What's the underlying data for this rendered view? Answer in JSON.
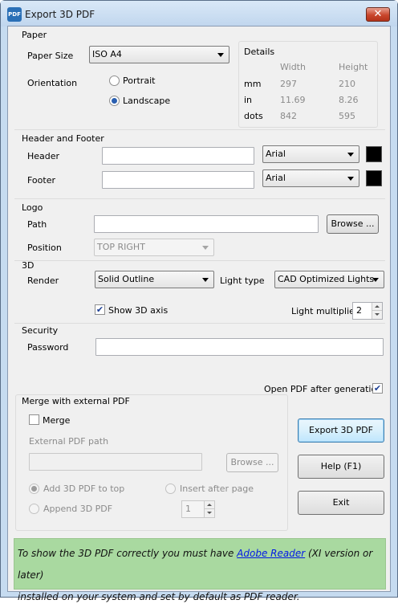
{
  "window": {
    "title": "Export 3D PDF",
    "app_icon_text": "PDF",
    "close_glyph": "✕"
  },
  "paper": {
    "group_label": "Paper",
    "size_label": "Paper Size",
    "size_value": "ISO A4",
    "orientation_label": "Orientation",
    "portrait_label": "Portrait",
    "landscape_label": "Landscape",
    "selected_orientation": "Landscape",
    "details": {
      "label": "Details",
      "col_width": "Width",
      "col_height": "Height",
      "rows": [
        {
          "unit": "mm",
          "width": "297",
          "height": "210"
        },
        {
          "unit": "in",
          "width": "11.69",
          "height": "8.26"
        },
        {
          "unit": "dots",
          "width": "842",
          "height": "595"
        }
      ]
    }
  },
  "header_footer": {
    "group_label": "Header and Footer",
    "header_label": "Header",
    "header_value": "",
    "header_font": "Arial",
    "header_color": "#000000",
    "footer_label": "Footer",
    "footer_value": "",
    "footer_font": "Arial",
    "footer_color": "#000000"
  },
  "logo": {
    "group_label": "Logo",
    "path_label": "Path",
    "path_value": "",
    "browse_label": "Browse ...",
    "position_label": "Position",
    "position_value": "TOP RIGHT"
  },
  "three_d": {
    "group_label": "3D",
    "render_label": "Render",
    "render_value": "Solid Outline",
    "light_type_label": "Light type",
    "light_type_value": "CAD Optimized Lights",
    "show_axis_label": "Show 3D axis",
    "show_axis_checked": true,
    "light_multiplier_label": "Light multiplier",
    "light_multiplier_value": "2"
  },
  "security": {
    "group_label": "Security",
    "password_label": "Password",
    "password_value": ""
  },
  "open_after": {
    "label": "Open PDF after generation",
    "checked": true
  },
  "merge": {
    "group_label": "Merge with external PDF",
    "merge_label": "Merge",
    "merge_checked": false,
    "external_path_label": "External PDF path",
    "external_path_value": "",
    "browse_label": "Browse ...",
    "add_top_label": "Add 3D PDF to top",
    "insert_after_label": "Insert after page",
    "append_label": "Append 3D PDF",
    "page_value": "1"
  },
  "actions": {
    "export_label": "Export 3D PDF",
    "help_label": "Help (F1)",
    "exit_label": "Exit"
  },
  "info": {
    "text_before": "To show the 3D PDF correctly you must have ",
    "link_text": "Adobe Reader",
    "text_after_link": " (XI version or later)",
    "line2": "installed on your system and set by default as PDF reader."
  },
  "colors": {
    "info_background": "#a9d9a0",
    "link": "#0018e6",
    "titlebar": "#c6dbf0",
    "close_button": "#c9462c"
  }
}
